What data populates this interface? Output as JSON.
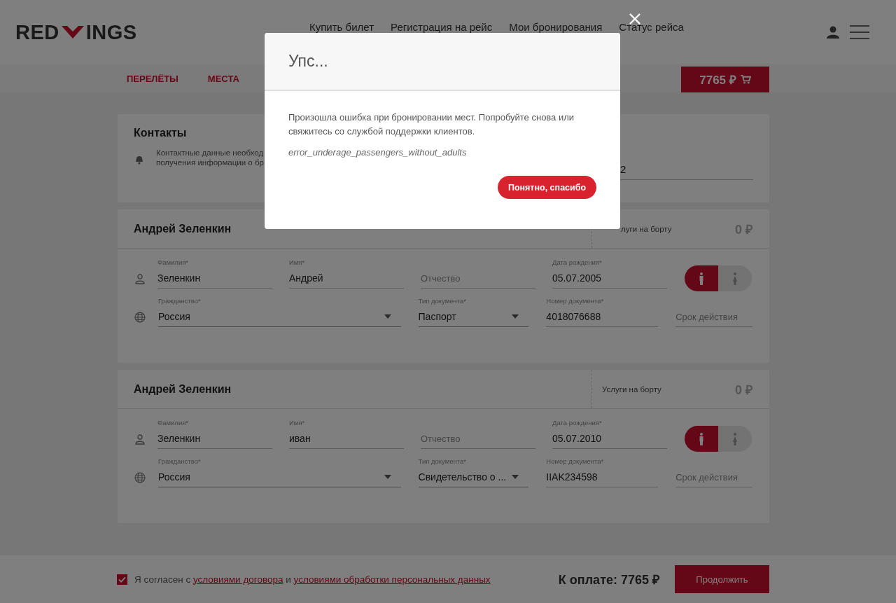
{
  "header": {
    "logo_left": "RED",
    "logo_right": "INGS",
    "nav": [
      "Купить билет",
      "Регистрация на рейс",
      "Мои бронирования",
      "Статус рейса"
    ]
  },
  "subnav": {
    "tabs": [
      {
        "label": "ПЕРЕЛЁТЫ",
        "selected": false
      },
      {
        "label": "МЕСТА",
        "selected": false
      }
    ],
    "cart_total": "7765 ₽"
  },
  "contacts": {
    "title": "Контакты",
    "note_lines": [
      "Контактные данные необход",
      "получения информации о бр"
    ],
    "field_value": "2"
  },
  "passengers": [
    {
      "name": "Андрей Зеленкин",
      "services_label": "луги на борту",
      "services_price": "0 ₽",
      "gender": [
        {
          "kind": "male",
          "selected": true
        },
        {
          "kind": "female",
          "selected": false
        }
      ],
      "personal_fields": [
        {
          "kind": "text",
          "label": "Фамилия*",
          "value": "Зеленкин"
        },
        {
          "kind": "text",
          "label": "Имя*",
          "value": "Андрей"
        },
        {
          "kind": "text",
          "placeholder": "Отчество"
        },
        {
          "kind": "text",
          "label": "Дата рождения*",
          "value": "05.07.2005"
        }
      ],
      "document_fields": [
        {
          "kind": "select",
          "label": "Гражданство*",
          "value": "Россия"
        },
        {
          "kind": "select",
          "label": "Тип документа*",
          "value": "Паспорт"
        },
        {
          "kind": "text",
          "label": "Номер документа*",
          "value": "4018076688"
        },
        {
          "kind": "text",
          "placeholder": "Срок действия"
        }
      ]
    },
    {
      "name": "Андрей Зеленкин",
      "services_label": "Услуги на борту",
      "services_price": "0 ₽",
      "gender": [
        {
          "kind": "male",
          "selected": true
        },
        {
          "kind": "female",
          "selected": false
        }
      ],
      "personal_fields": [
        {
          "kind": "text",
          "label": "Фамилия*",
          "value": "Зеленкин"
        },
        {
          "kind": "text",
          "label": "Имя*",
          "value": "иван"
        },
        {
          "kind": "text",
          "placeholder": "Отчество"
        },
        {
          "kind": "text",
          "label": "Дата рождения*",
          "value": "05.07.2010"
        }
      ],
      "document_fields": [
        {
          "kind": "select",
          "label": "Гражданство*",
          "value": "Россия"
        },
        {
          "kind": "select",
          "label": "Тип документа*",
          "value": "Свидетельство о ..."
        },
        {
          "kind": "text",
          "label": "Номер документа*",
          "value": "IIAK234598"
        },
        {
          "kind": "text",
          "placeholder": "Срок действия"
        }
      ]
    }
  ],
  "footer": {
    "agree_checked": true,
    "agree_text": "Я согласен с",
    "link_1": "условиями договора",
    "joiner": "и",
    "link_2": "условиями обработки персональных данных",
    "total": "К оплате: 7765 ₽",
    "continue": "Продолжить"
  },
  "modal": {
    "title": "Упс...",
    "message": "Произошла ошибка при бронировании мест. Попробуйте снова или свяжитесь со службой поддержки клиентов.",
    "code": "error_underage_passengers_without_adults",
    "button": "Понятно, спасибо"
  }
}
